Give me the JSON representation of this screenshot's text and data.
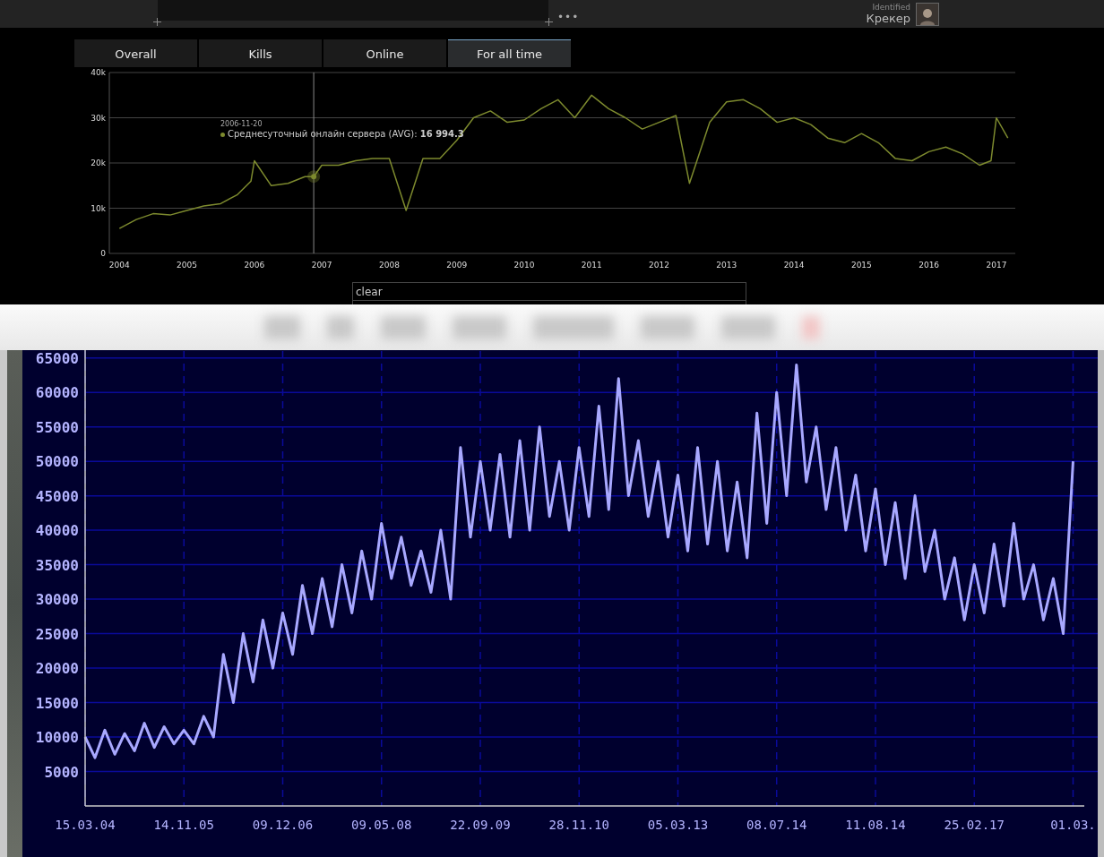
{
  "header": {
    "menu_dots": "•••",
    "user_status": "Identified",
    "user_name": "Крекер"
  },
  "tabs": [
    {
      "label": "Overall",
      "selected": false
    },
    {
      "label": "Kills",
      "selected": false
    },
    {
      "label": "Online",
      "selected": false
    },
    {
      "label": "For all time",
      "selected": true
    }
  ],
  "online_chart": {
    "tooltip": {
      "date": "2006-11-20"
    },
    "chart_data": {
      "type": "line",
      "grid": true,
      "x": [
        2004.0,
        2004.25,
        2004.5,
        2004.75,
        2005.0,
        2005.25,
        2005.5,
        2005.75,
        2005.95,
        2006.0,
        2006.25,
        2006.5,
        2006.75,
        2006.88,
        2007.0,
        2007.25,
        2007.5,
        2007.75,
        2008.0,
        2008.25,
        2008.5,
        2008.75,
        2009.0,
        2009.25,
        2009.5,
        2009.75,
        2010.0,
        2010.25,
        2010.5,
        2010.75,
        2011.0,
        2011.25,
        2011.5,
        2011.75,
        2012.0,
        2012.25,
        2012.45,
        2012.75,
        2013.0,
        2013.25,
        2013.5,
        2013.75,
        2014.0,
        2014.25,
        2014.5,
        2014.75,
        2015.0,
        2015.25,
        2015.5,
        2015.75,
        2016.0,
        2016.25,
        2016.5,
        2016.75,
        2016.92,
        2017.0,
        2017.17
      ],
      "series": [
        {
          "name": "Среднесуточный онлайн сервера",
          "color": "#7d8a2e",
          "values": [
            5500,
            7500,
            8800,
            8500,
            9500,
            10500,
            11000,
            13000,
            16000,
            20500,
            15000,
            15500,
            17000,
            17000,
            19500,
            19500,
            20500,
            21000,
            21000,
            9500,
            21000,
            21000,
            25000,
            30000,
            31500,
            29000,
            29500,
            32000,
            34000,
            30000,
            35000,
            32000,
            30000,
            27500,
            29000,
            30500,
            15500,
            29000,
            33500,
            34000,
            32000,
            29000,
            30000,
            28500,
            25500,
            24500,
            26500,
            24500,
            21000,
            20500,
            22500,
            23500,
            22000,
            19500,
            20500,
            30000,
            25500
          ]
        }
      ],
      "xlim": [
        2003.85,
        2017.28
      ],
      "ylim": [
        0,
        40000
      ],
      "xticks": [
        2004,
        2005,
        2006,
        2007,
        2008,
        2009,
        2010,
        2011,
        2012,
        2013,
        2014,
        2015,
        2016,
        2017
      ],
      "yticks": [
        {
          "value": 0,
          "label": "0"
        },
        {
          "value": 10000,
          "label": "10k"
        },
        {
          "value": 20000,
          "label": "20k"
        },
        {
          "value": 30000,
          "label": "30k"
        },
        {
          "value": 40000,
          "label": "40k"
        }
      ],
      "ref_lines": [
        {
          "axis": "x",
          "value": 2006.88
        }
      ],
      "annotations": [
        "(AVG): **16 994.3**"
      ]
    }
  },
  "filter": {
    "value": "clear"
  },
  "history_chart": {
    "chart_data": {
      "type": "line",
      "grid": true,
      "categories": [
        "15.03.04",
        null,
        null,
        null,
        null,
        null,
        null,
        null,
        null,
        null,
        "14.11.05",
        null,
        null,
        null,
        null,
        null,
        null,
        null,
        null,
        null,
        "09.12.06",
        null,
        null,
        null,
        null,
        null,
        null,
        null,
        null,
        null,
        "09.05.08",
        null,
        null,
        null,
        null,
        null,
        null,
        null,
        null,
        null,
        "22.09.09",
        null,
        null,
        null,
        null,
        null,
        null,
        null,
        null,
        null,
        "28.11.10",
        null,
        null,
        null,
        null,
        null,
        null,
        null,
        null,
        null,
        "05.03.13",
        null,
        null,
        null,
        null,
        null,
        null,
        null,
        null,
        null,
        "08.07.14",
        null,
        null,
        null,
        null,
        null,
        null,
        null,
        null,
        null,
        "11.08.14",
        null,
        null,
        null,
        null,
        null,
        null,
        null,
        null,
        null,
        "25.02.17",
        null,
        null,
        null,
        null,
        null,
        null,
        null,
        null,
        null,
        "01.03."
      ],
      "series": [
        {
          "color": "#a8a8ff",
          "values": [
            10000,
            7000,
            11000,
            7500,
            10500,
            8000,
            12000,
            8500,
            11500,
            9000,
            11000,
            9000,
            13000,
            10000,
            22000,
            15000,
            25000,
            18000,
            27000,
            20000,
            28000,
            22000,
            32000,
            25000,
            33000,
            26000,
            35000,
            28000,
            37000,
            30000,
            41000,
            33000,
            39000,
            32000,
            37000,
            31000,
            40000,
            30000,
            52000,
            39000,
            50000,
            40000,
            51000,
            39000,
            53000,
            40000,
            55000,
            42000,
            50000,
            40000,
            52000,
            42000,
            58000,
            43000,
            62000,
            45000,
            53000,
            42000,
            50000,
            39000,
            48000,
            37000,
            52000,
            38000,
            50000,
            37000,
            47000,
            36000,
            57000,
            41000,
            60000,
            45000,
            64000,
            47000,
            55000,
            43000,
            52000,
            40000,
            48000,
            37000,
            46000,
            35000,
            44000,
            33000,
            45000,
            34000,
            40000,
            30000,
            36000,
            27000,
            35000,
            28000,
            38000,
            29000,
            41000,
            30000,
            35000,
            27000,
            33000,
            25000,
            50000
          ]
        }
      ],
      "ylim": [
        0,
        66000
      ],
      "yticks": [
        5000,
        10000,
        15000,
        20000,
        25000,
        30000,
        35000,
        40000,
        45000,
        50000,
        55000,
        60000,
        65000
      ]
    }
  }
}
